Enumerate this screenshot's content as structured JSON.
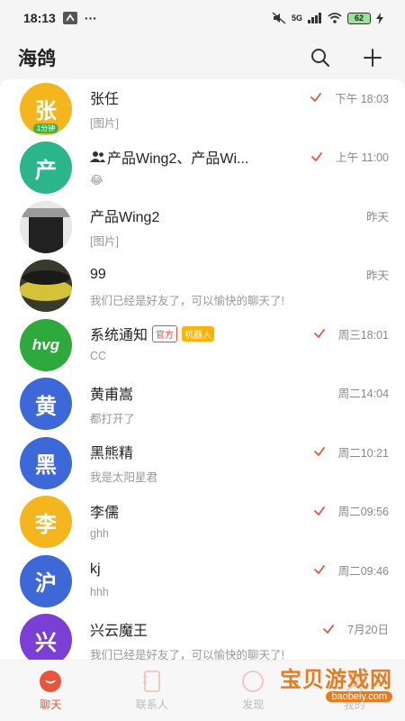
{
  "status_bar": {
    "time": "18:13",
    "dots": "···",
    "network": "5G",
    "battery": "62"
  },
  "header": {
    "title": "海鸽"
  },
  "chats": [
    {
      "avatar_text": "张",
      "avatar_color": "#f5b51d",
      "badge": "1分钟",
      "name": "张任",
      "preview": "[图片]",
      "time": "下午 18:03",
      "read_check": true
    },
    {
      "avatar_text": "产",
      "avatar_color": "#2bb58a",
      "name": "产品Wing2、产品Wi...",
      "preview": "😂",
      "time": "上午 11:00",
      "read_check": true,
      "group": true
    },
    {
      "avatar_text": "",
      "avatar_color": "#cfcfcf",
      "avatar_image": "photo-dark",
      "name": "产品Wing2",
      "preview": "[图片]",
      "time": "昨天",
      "read_check": false
    },
    {
      "avatar_text": "",
      "avatar_color": "#5a5a3a",
      "avatar_image": "photo-car",
      "name": "99",
      "preview": "我们已经是好友了，可以愉快的聊天了!",
      "time": "昨天",
      "read_check": false
    },
    {
      "avatar_text": "hvg",
      "avatar_color": "#2eaa3c",
      "name": "系统通知",
      "tag_official": "官方",
      "tag_robot": "机器人",
      "preview": "CC",
      "time": "周三18:01",
      "read_check": true
    },
    {
      "avatar_text": "黄",
      "avatar_color": "#3c68d8",
      "name": "黄甫嵩",
      "preview": "都打开了",
      "time": "周二14:04",
      "read_check": false
    },
    {
      "avatar_text": "黑",
      "avatar_color": "#3c68d8",
      "name": "黑熊精",
      "preview": "我是太阳星君",
      "time": "周二10:21",
      "read_check": true
    },
    {
      "avatar_text": "李",
      "avatar_color": "#f5b51d",
      "name": "李儒",
      "preview": "ghh",
      "time": "周二09:56",
      "read_check": true
    },
    {
      "avatar_text": "沪",
      "avatar_color": "#3c68d8",
      "name": "kj",
      "preview": "hhh",
      "time": "周二09:46",
      "read_check": true
    },
    {
      "avatar_text": "兴",
      "avatar_color": "#7b3fd6",
      "name": "兴云魔王",
      "preview": "我们已经是好友了，可以愉快的聊天了!",
      "time": "7月20日",
      "read_check": true
    }
  ],
  "bottom_nav": [
    {
      "label": "聊天",
      "active": true
    },
    {
      "label": "联系人",
      "active": false
    },
    {
      "label": "发现",
      "active": false
    },
    {
      "label": "我的",
      "active": false
    }
  ],
  "watermark": {
    "title": "宝贝游戏网",
    "url": "baobeiy.com"
  },
  "colors": {
    "accent": "#e8543c",
    "check": "#e8543c",
    "background": "#f5f5f5"
  }
}
